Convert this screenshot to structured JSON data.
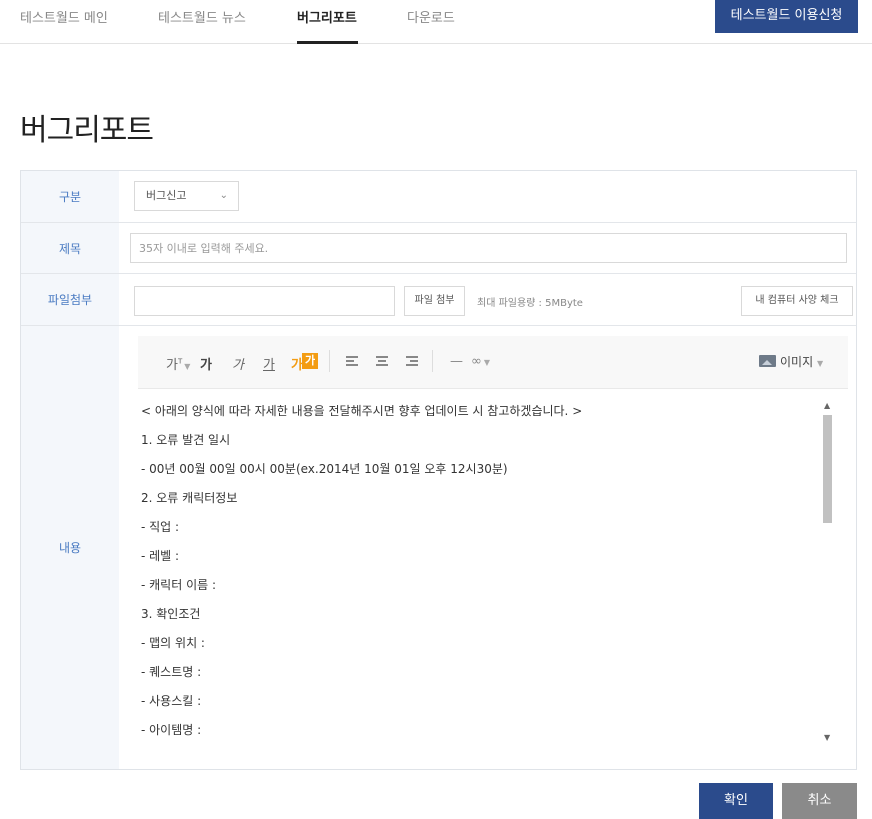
{
  "nav": {
    "items": [
      "테스트월드 메인",
      "테스트월드 뉴스",
      "버그리포트",
      "다운로드"
    ],
    "active_index": 2,
    "apply_button": "테스트월드 이용신청"
  },
  "page_title": "버그리포트",
  "form": {
    "category": {
      "label": "구분",
      "selected": "버그신고"
    },
    "subject": {
      "label": "제목",
      "placeholder": "35자 이내로 입력해 주세요."
    },
    "attachment": {
      "label": "파일첨부",
      "attach_button": "파일 첨부",
      "size_note": "최대 파일용량 : 5MByte",
      "spec_button": "내 컴퓨터 사양 체크"
    },
    "content": {
      "label": "내용",
      "toolbar": {
        "font_size": "가",
        "bold": "가",
        "italic": "가",
        "underline": "가",
        "font_color": "가",
        "highlight": "가",
        "image_button": "이미지"
      },
      "lines": [
        "< 아래의 양식에 따라 자세한 내용을 전달해주시면 향후 업데이트 시 참고하겠습니다. >",
        "1. 오류 발견 일시",
        "- 00년 00월 00일 00시 00분(ex.2014년 10월 01일 오후 12시30분)",
        "2. 오류 캐릭터정보",
        "- 직업 :",
        "- 레벨 :",
        "- 캐릭터 이름 :",
        "3. 확인조건",
        "- 맵의 위치 :",
        "- 퀘스트명 :",
        "- 사용스킬 :",
        "- 아이템명 :"
      ]
    }
  },
  "buttons": {
    "confirm": "확인",
    "cancel": "취소"
  },
  "colors": {
    "primary": "#2b4b8c",
    "label_text": "#4a7bc2",
    "label_bg": "#f4f7fb",
    "accent": "#f39c12",
    "cancel": "#8a8a8a"
  }
}
